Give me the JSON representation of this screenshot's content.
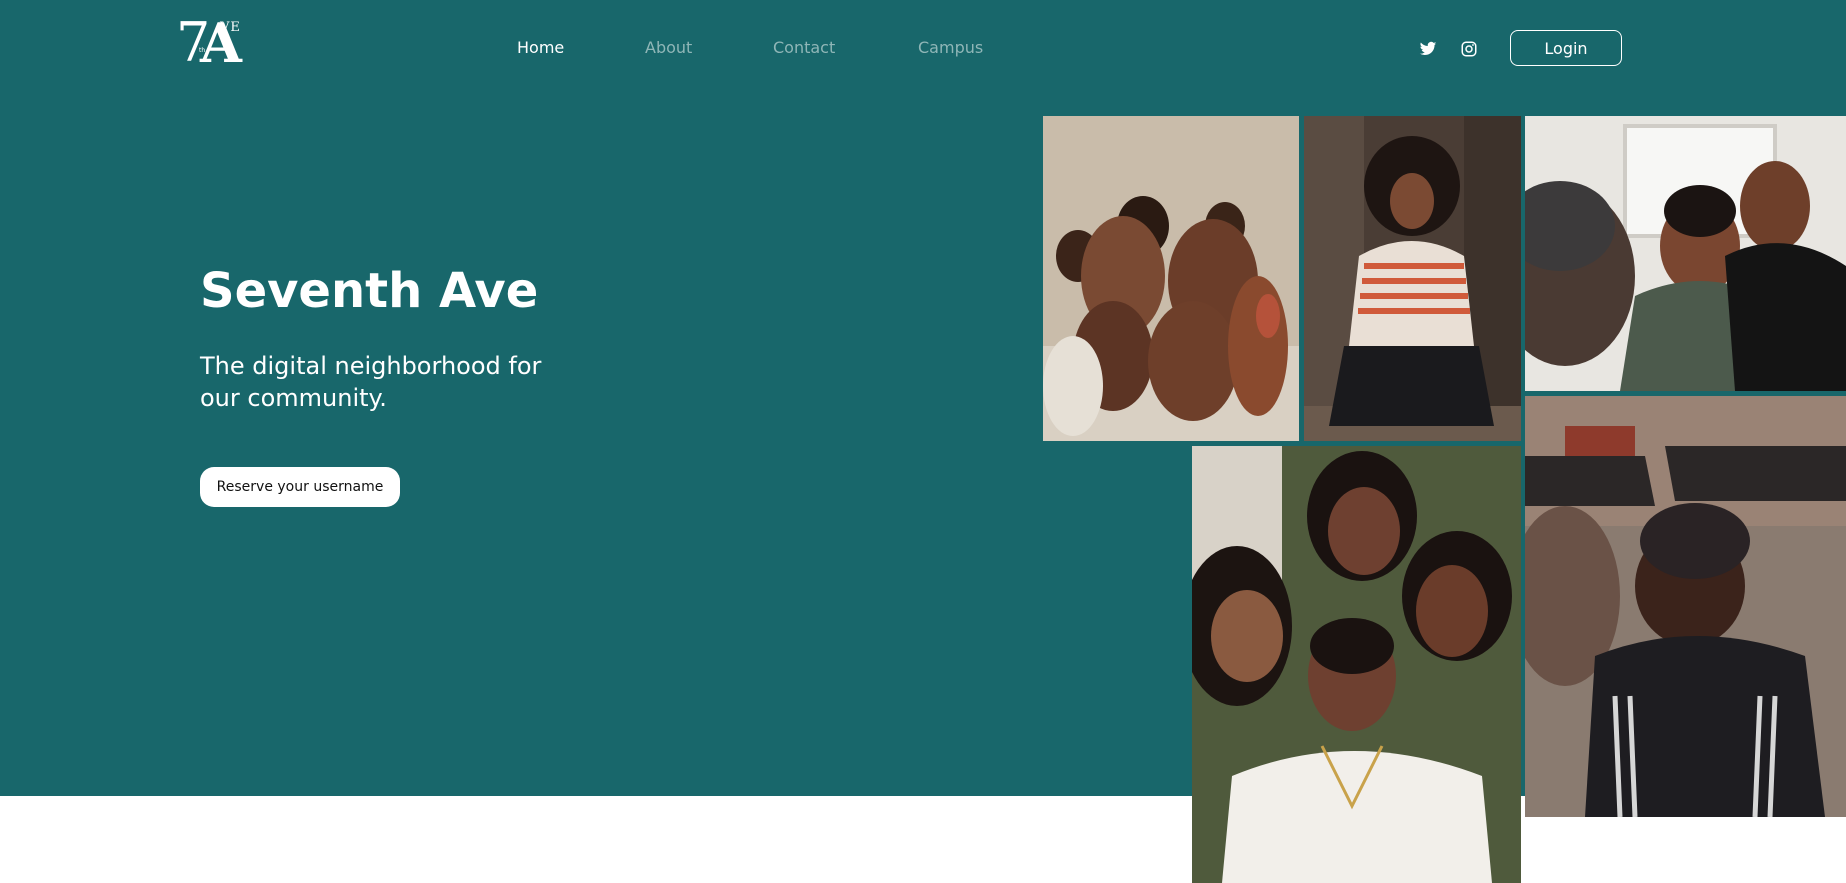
{
  "brand": {
    "logo_alt": "7th Ave",
    "logo_text": {
      "seven": "7",
      "big_a": "A",
      "ve": "VE",
      "th": "th"
    }
  },
  "nav": {
    "items": [
      {
        "label": "Home",
        "active": true
      },
      {
        "label": "About",
        "active": false
      },
      {
        "label": "Contact",
        "active": false
      },
      {
        "label": "Campus",
        "active": false
      }
    ]
  },
  "social": [
    {
      "icon": "twitter-icon"
    },
    {
      "icon": "instagram-icon"
    }
  ],
  "header": {
    "login_label": "Login"
  },
  "hero": {
    "title": "Seventh Ave",
    "subtitle": "The digital neighborhood for our community.",
    "cta_label": "Reserve your username"
  },
  "colors": {
    "hero_bg": "#18676b",
    "nav_inactive": "#8fb6b7",
    "text_light": "#ffffff"
  }
}
